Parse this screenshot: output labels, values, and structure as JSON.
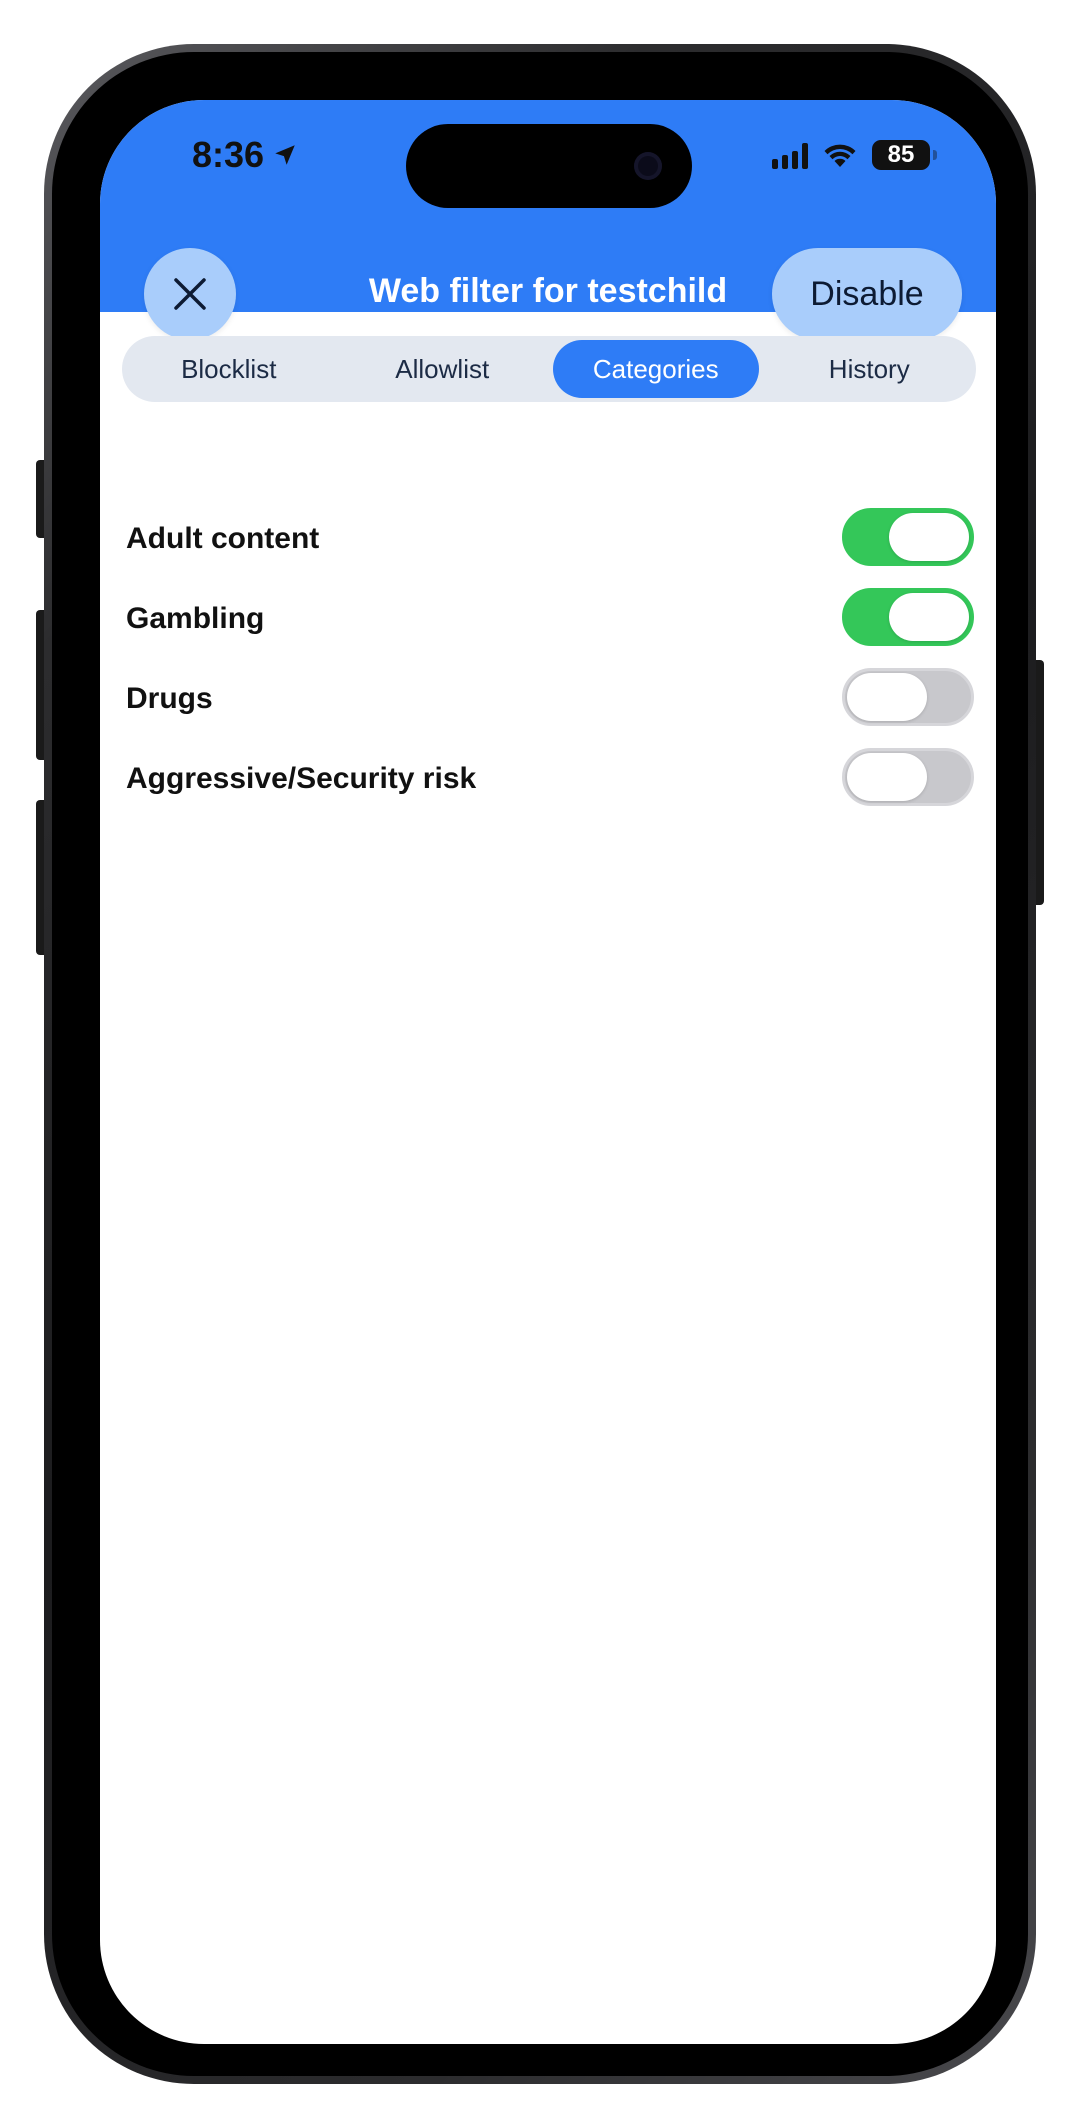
{
  "status_bar": {
    "time": "8:36",
    "battery": "85"
  },
  "header": {
    "title": "Web filter for testchild",
    "disable_label": "Disable",
    "accent_color": "#2e7cf6"
  },
  "tabs": [
    {
      "label": "Blocklist",
      "active": false
    },
    {
      "label": "Allowlist",
      "active": false
    },
    {
      "label": "Categories",
      "active": true
    },
    {
      "label": "History",
      "active": false
    }
  ],
  "categories": [
    {
      "label": "Adult content",
      "enabled": true
    },
    {
      "label": "Gambling",
      "enabled": true
    },
    {
      "label": "Drugs",
      "enabled": false
    },
    {
      "label": "Aggressive/Security risk",
      "enabled": false
    }
  ],
  "icons": {
    "close": "close-icon",
    "location": "location-arrow-icon",
    "signal": "cellular-signal-icon",
    "wifi": "wifi-icon",
    "battery": "battery-icon"
  },
  "colors": {
    "toggle_on": "#34c759",
    "toggle_off": "#c8c8cc"
  }
}
